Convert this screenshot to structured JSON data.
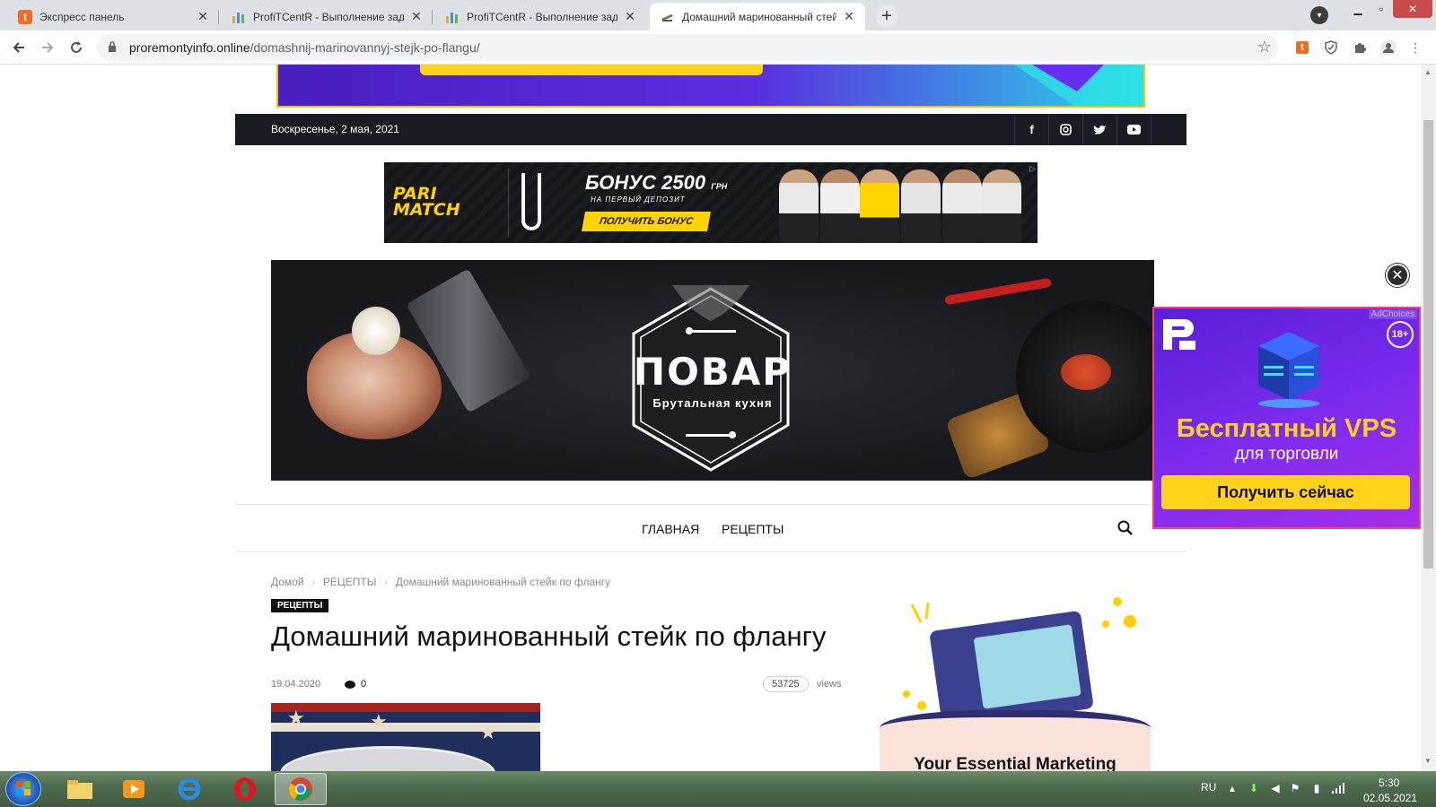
{
  "browser": {
    "tabs": [
      {
        "title": "Экспресс панель",
        "favicon": "t-favicon"
      },
      {
        "title": "ProfiTCentR - Выполнение задач",
        "favicon": "chart-favicon"
      },
      {
        "title": "ProfiTCentR - Выполнение задач",
        "favicon": "chart-favicon"
      },
      {
        "title": "Домашний маринованный стейк",
        "favicon": "cooking-favicon"
      }
    ],
    "new_tab_label": "+",
    "url_domain": "proremontyinfo.online",
    "url_path": "/domashnij-marinovannyj-stejk-po-flangu/"
  },
  "site": {
    "date": "Воскресенье, 2 мая, 2021",
    "social": [
      "f",
      "instagram",
      "twitter",
      "youtube"
    ],
    "nav": [
      "ГЛАВНАЯ",
      "РЕЦЕПТЫ"
    ],
    "hero": {
      "title": "ПОВАР",
      "subtitle": "Брутальная кухня"
    }
  },
  "ads": {
    "parimatch": {
      "logo_line1": "PARI",
      "logo_line2": "MATCH",
      "bonus": "БОНУС 2500",
      "bonus_unit": "ГРН",
      "bonus_sub": "НА ПЕРВЫЙ ДЕПОЗИТ",
      "cta": "ПОЛУЧИТЬ БОНУС"
    },
    "vps": {
      "adchoices": "AdChoices",
      "age": "18+",
      "title": "Бесплатный VPS",
      "subtitle": "для торговли",
      "cta": "Получить сейчас"
    },
    "marketing": {
      "title": "Your Essential Marketing"
    }
  },
  "article": {
    "breadcrumb": [
      "Домой",
      "РЕЦЕПТЫ",
      "Домашний маринованный стейк по флангу"
    ],
    "category": "РЕЦЕПТЫ",
    "title": "Домашний маринованный стейк по флангу",
    "date": "19.04.2020",
    "comments": "0",
    "views_count": "53725",
    "views_label": "views"
  },
  "taskbar": {
    "lang": "RU",
    "time": "5:30",
    "date": "02.05.2021"
  },
  "colors": {
    "accent_yellow": "#ffd21c",
    "topbar_dark": "#1a1c23",
    "vps_purple": "#7b2bee"
  }
}
